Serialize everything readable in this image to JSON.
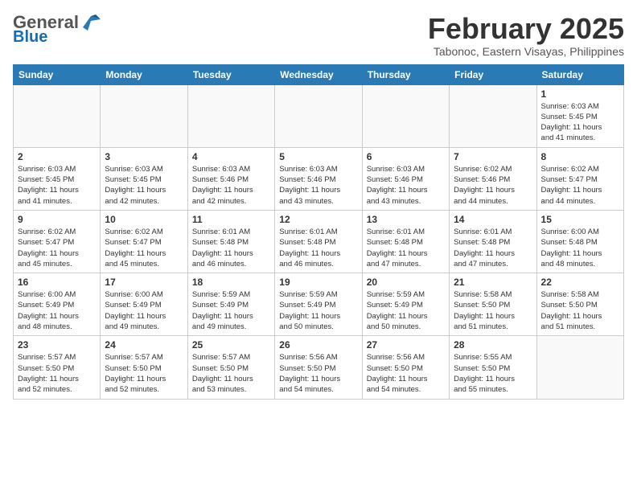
{
  "header": {
    "logo_general": "General",
    "logo_blue": "Blue",
    "month_year": "February 2025",
    "location": "Tabonoc, Eastern Visayas, Philippines"
  },
  "weekdays": [
    "Sunday",
    "Monday",
    "Tuesday",
    "Wednesday",
    "Thursday",
    "Friday",
    "Saturday"
  ],
  "weeks": [
    [
      {
        "day": "",
        "info": ""
      },
      {
        "day": "",
        "info": ""
      },
      {
        "day": "",
        "info": ""
      },
      {
        "day": "",
        "info": ""
      },
      {
        "day": "",
        "info": ""
      },
      {
        "day": "",
        "info": ""
      },
      {
        "day": "1",
        "info": "Sunrise: 6:03 AM\nSunset: 5:45 PM\nDaylight: 11 hours\nand 41 minutes."
      }
    ],
    [
      {
        "day": "2",
        "info": "Sunrise: 6:03 AM\nSunset: 5:45 PM\nDaylight: 11 hours\nand 41 minutes."
      },
      {
        "day": "3",
        "info": "Sunrise: 6:03 AM\nSunset: 5:45 PM\nDaylight: 11 hours\nand 42 minutes."
      },
      {
        "day": "4",
        "info": "Sunrise: 6:03 AM\nSunset: 5:46 PM\nDaylight: 11 hours\nand 42 minutes."
      },
      {
        "day": "5",
        "info": "Sunrise: 6:03 AM\nSunset: 5:46 PM\nDaylight: 11 hours\nand 43 minutes."
      },
      {
        "day": "6",
        "info": "Sunrise: 6:03 AM\nSunset: 5:46 PM\nDaylight: 11 hours\nand 43 minutes."
      },
      {
        "day": "7",
        "info": "Sunrise: 6:02 AM\nSunset: 5:46 PM\nDaylight: 11 hours\nand 44 minutes."
      },
      {
        "day": "8",
        "info": "Sunrise: 6:02 AM\nSunset: 5:47 PM\nDaylight: 11 hours\nand 44 minutes."
      }
    ],
    [
      {
        "day": "9",
        "info": "Sunrise: 6:02 AM\nSunset: 5:47 PM\nDaylight: 11 hours\nand 45 minutes."
      },
      {
        "day": "10",
        "info": "Sunrise: 6:02 AM\nSunset: 5:47 PM\nDaylight: 11 hours\nand 45 minutes."
      },
      {
        "day": "11",
        "info": "Sunrise: 6:01 AM\nSunset: 5:48 PM\nDaylight: 11 hours\nand 46 minutes."
      },
      {
        "day": "12",
        "info": "Sunrise: 6:01 AM\nSunset: 5:48 PM\nDaylight: 11 hours\nand 46 minutes."
      },
      {
        "day": "13",
        "info": "Sunrise: 6:01 AM\nSunset: 5:48 PM\nDaylight: 11 hours\nand 47 minutes."
      },
      {
        "day": "14",
        "info": "Sunrise: 6:01 AM\nSunset: 5:48 PM\nDaylight: 11 hours\nand 47 minutes."
      },
      {
        "day": "15",
        "info": "Sunrise: 6:00 AM\nSunset: 5:48 PM\nDaylight: 11 hours\nand 48 minutes."
      }
    ],
    [
      {
        "day": "16",
        "info": "Sunrise: 6:00 AM\nSunset: 5:49 PM\nDaylight: 11 hours\nand 48 minutes."
      },
      {
        "day": "17",
        "info": "Sunrise: 6:00 AM\nSunset: 5:49 PM\nDaylight: 11 hours\nand 49 minutes."
      },
      {
        "day": "18",
        "info": "Sunrise: 5:59 AM\nSunset: 5:49 PM\nDaylight: 11 hours\nand 49 minutes."
      },
      {
        "day": "19",
        "info": "Sunrise: 5:59 AM\nSunset: 5:49 PM\nDaylight: 11 hours\nand 50 minutes."
      },
      {
        "day": "20",
        "info": "Sunrise: 5:59 AM\nSunset: 5:49 PM\nDaylight: 11 hours\nand 50 minutes."
      },
      {
        "day": "21",
        "info": "Sunrise: 5:58 AM\nSunset: 5:50 PM\nDaylight: 11 hours\nand 51 minutes."
      },
      {
        "day": "22",
        "info": "Sunrise: 5:58 AM\nSunset: 5:50 PM\nDaylight: 11 hours\nand 51 minutes."
      }
    ],
    [
      {
        "day": "23",
        "info": "Sunrise: 5:57 AM\nSunset: 5:50 PM\nDaylight: 11 hours\nand 52 minutes."
      },
      {
        "day": "24",
        "info": "Sunrise: 5:57 AM\nSunset: 5:50 PM\nDaylight: 11 hours\nand 52 minutes."
      },
      {
        "day": "25",
        "info": "Sunrise: 5:57 AM\nSunset: 5:50 PM\nDaylight: 11 hours\nand 53 minutes."
      },
      {
        "day": "26",
        "info": "Sunrise: 5:56 AM\nSunset: 5:50 PM\nDaylight: 11 hours\nand 54 minutes."
      },
      {
        "day": "27",
        "info": "Sunrise: 5:56 AM\nSunset: 5:50 PM\nDaylight: 11 hours\nand 54 minutes."
      },
      {
        "day": "28",
        "info": "Sunrise: 5:55 AM\nSunset: 5:50 PM\nDaylight: 11 hours\nand 55 minutes."
      },
      {
        "day": "",
        "info": ""
      }
    ]
  ]
}
